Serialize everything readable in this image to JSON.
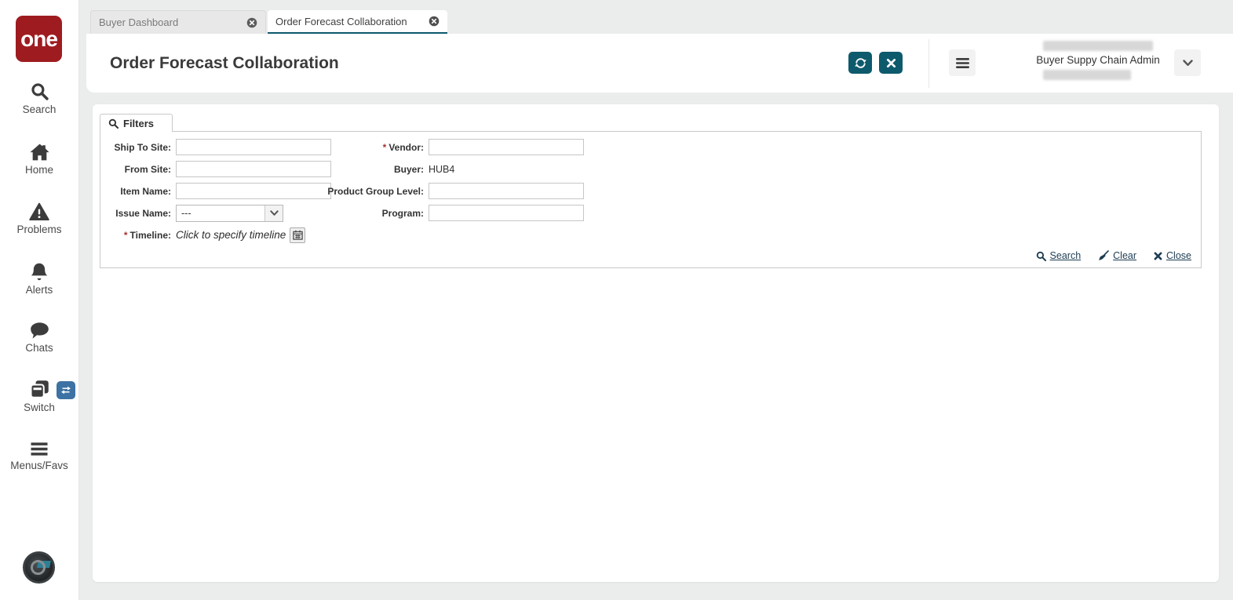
{
  "brand": {
    "logo_text": "one",
    "logo_color": "#9e1c20"
  },
  "colors": {
    "accent_teal": "#0d5a6c",
    "link": "#1d3c52",
    "required_red": "#a63232",
    "switch_badge_blue": "#3d72a4",
    "background_gray": "#ebecec"
  },
  "sidebar": {
    "items": [
      {
        "label": "Search"
      },
      {
        "label": "Home"
      },
      {
        "label": "Problems"
      },
      {
        "label": "Alerts"
      },
      {
        "label": "Chats"
      },
      {
        "label": "Switch"
      },
      {
        "label": "Menus/Favs"
      }
    ]
  },
  "tabs": [
    {
      "label": "Buyer Dashboard",
      "active": false
    },
    {
      "label": "Order Forecast Collaboration",
      "active": true
    }
  ],
  "header": {
    "title": "Order Forecast Collaboration",
    "user_role": "Buyer Suppy Chain Admin"
  },
  "filters": {
    "tab_label": "Filters",
    "required_marker": "*",
    "left_fields": [
      {
        "label": "Ship To Site:",
        "type": "text",
        "value": ""
      },
      {
        "label": "From Site:",
        "type": "text",
        "value": ""
      },
      {
        "label": "Item Name:",
        "type": "text",
        "value": ""
      },
      {
        "label": "Issue Name:",
        "type": "select",
        "value": "---"
      },
      {
        "label": "Timeline:",
        "required": true,
        "type": "timeline",
        "placeholder": "Click to specify timeline"
      }
    ],
    "right_fields": [
      {
        "label": "Vendor:",
        "required": true,
        "type": "text",
        "value": ""
      },
      {
        "label": "Buyer:",
        "type": "static",
        "value": "HUB4"
      },
      {
        "label": "Product Group Level:",
        "type": "text",
        "value": ""
      },
      {
        "label": "Program:",
        "type": "text",
        "value": ""
      }
    ],
    "actions": [
      {
        "label": "Search"
      },
      {
        "label": "Clear"
      },
      {
        "label": "Close"
      }
    ]
  }
}
